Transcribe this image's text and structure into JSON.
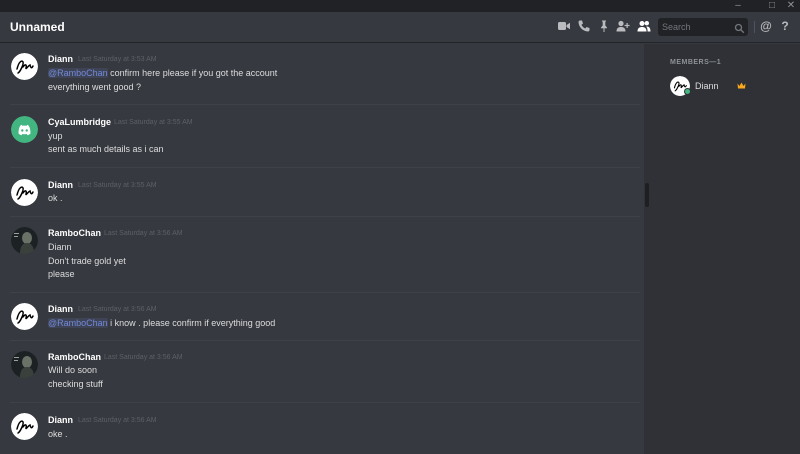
{
  "window": {
    "controls": {
      "minimize": "–",
      "maximize": "□",
      "close": "✕"
    }
  },
  "header": {
    "channel_name": "Unnamed",
    "icons": [
      "video-call-icon",
      "voice-call-icon",
      "pin-icon",
      "add-friend-icon",
      "members-list-icon"
    ],
    "search": {
      "placeholder": "Search",
      "value": ""
    },
    "mention_label": "@",
    "help_label": "?"
  },
  "messages": [
    {
      "author": "Diann",
      "avatar": "diann-avatar",
      "timestamp": "Last Saturday at 3:53 AM",
      "lines": [
        {
          "mention": "@RamboChan",
          "text": " confirm here please if you got the account"
        },
        {
          "text": "everything went good ?"
        }
      ]
    },
    {
      "author": "CyaLumbridge",
      "avatar": "discord-default-avatar",
      "timestamp": "Last Saturday at 3:55 AM",
      "lines": [
        {
          "text": "yup"
        },
        {
          "text": "sent as much details as i can"
        }
      ]
    },
    {
      "author": "Diann",
      "avatar": "diann-avatar",
      "timestamp": "Last Saturday at 3:55 AM",
      "lines": [
        {
          "text": "ok ."
        }
      ]
    },
    {
      "author": "RamboChan",
      "avatar": "rambochan-avatar",
      "timestamp": "Last Saturday at 3:56 AM",
      "lines": [
        {
          "text": "Diann"
        },
        {
          "text": "Don't trade gold yet"
        },
        {
          "text": "please"
        }
      ]
    },
    {
      "author": "Diann",
      "avatar": "diann-avatar",
      "timestamp": "Last Saturday at 3:56 AM",
      "lines": [
        {
          "mention": "@RamboChan",
          "text": " i know . please confirm if everything good"
        }
      ]
    },
    {
      "author": "RamboChan",
      "avatar": "rambochan-avatar",
      "timestamp": "Last Saturday at 3:56 AM",
      "lines": [
        {
          "text": "Will do soon"
        },
        {
          "text": "checking stuff"
        }
      ]
    },
    {
      "author": "Diann",
      "avatar": "diann-avatar",
      "timestamp": "Last Saturday at 3:56 AM",
      "lines": [
        {
          "text": "oke ."
        }
      ]
    }
  ],
  "members_panel": {
    "heading": "MEMBERS—1",
    "members": [
      {
        "name": "Diann",
        "status": "online",
        "owner_icon": "crown-icon"
      }
    ]
  },
  "colors": {
    "background": "#36393f",
    "sidebar": "#2f3136",
    "titlebar": "#202225",
    "mention": "#7289da",
    "discord_blurple": "#7289da",
    "default_avatar_green": "#43b581",
    "online": "#43b581",
    "crown": "#faa61a"
  }
}
